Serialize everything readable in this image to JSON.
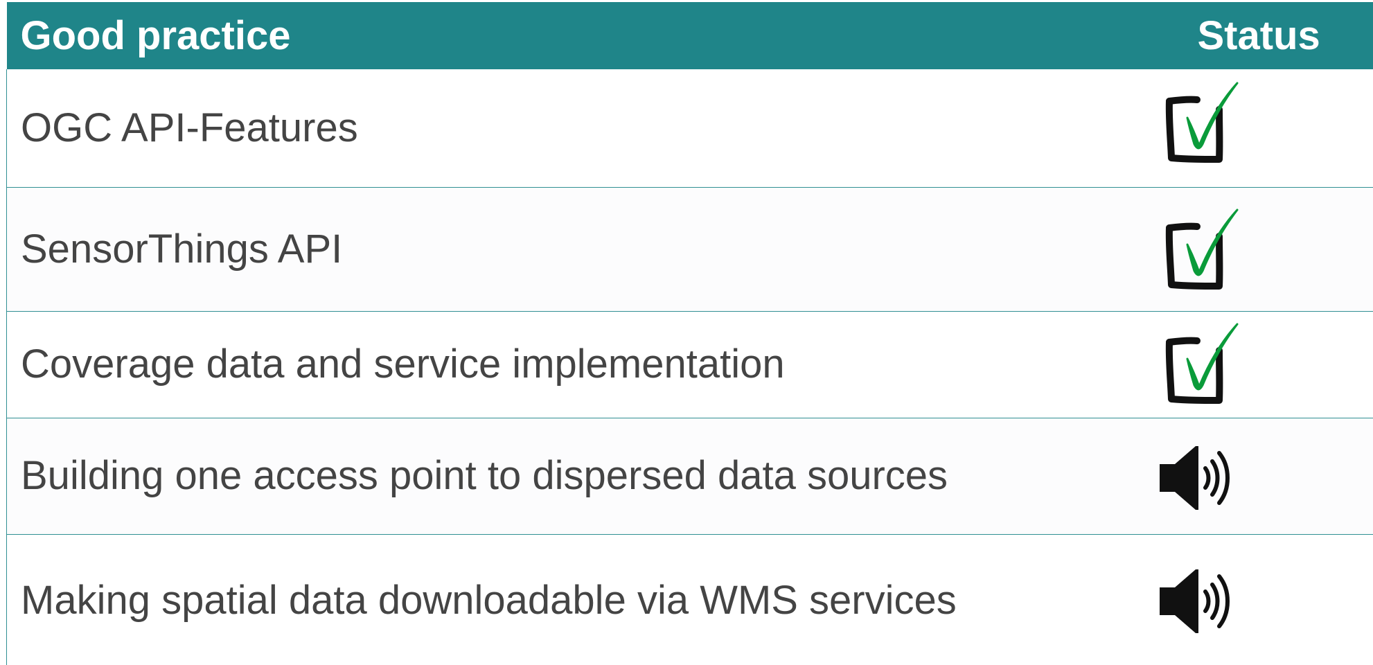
{
  "table": {
    "headers": {
      "practice": "Good practice",
      "status": "Status"
    },
    "rows": [
      {
        "label": "OGC API-Features",
        "status_icon": "checked-box-icon"
      },
      {
        "label": "SensorThings API",
        "status_icon": "checked-box-icon"
      },
      {
        "label": "Coverage data and service implementation",
        "status_icon": "checked-box-icon"
      },
      {
        "label": "Building one access point to dispersed data sources",
        "status_icon": "speaker-icon"
      },
      {
        "label": "Making spatial data downloadable via WMS services",
        "status_icon": "speaker-icon"
      }
    ]
  },
  "colors": {
    "header_background": "#1f8589",
    "header_text": "#ffffff",
    "body_text": "#444444",
    "divider": "#2f8f93",
    "check_mark": "#0a9b3a",
    "icon_dark": "#111111"
  }
}
